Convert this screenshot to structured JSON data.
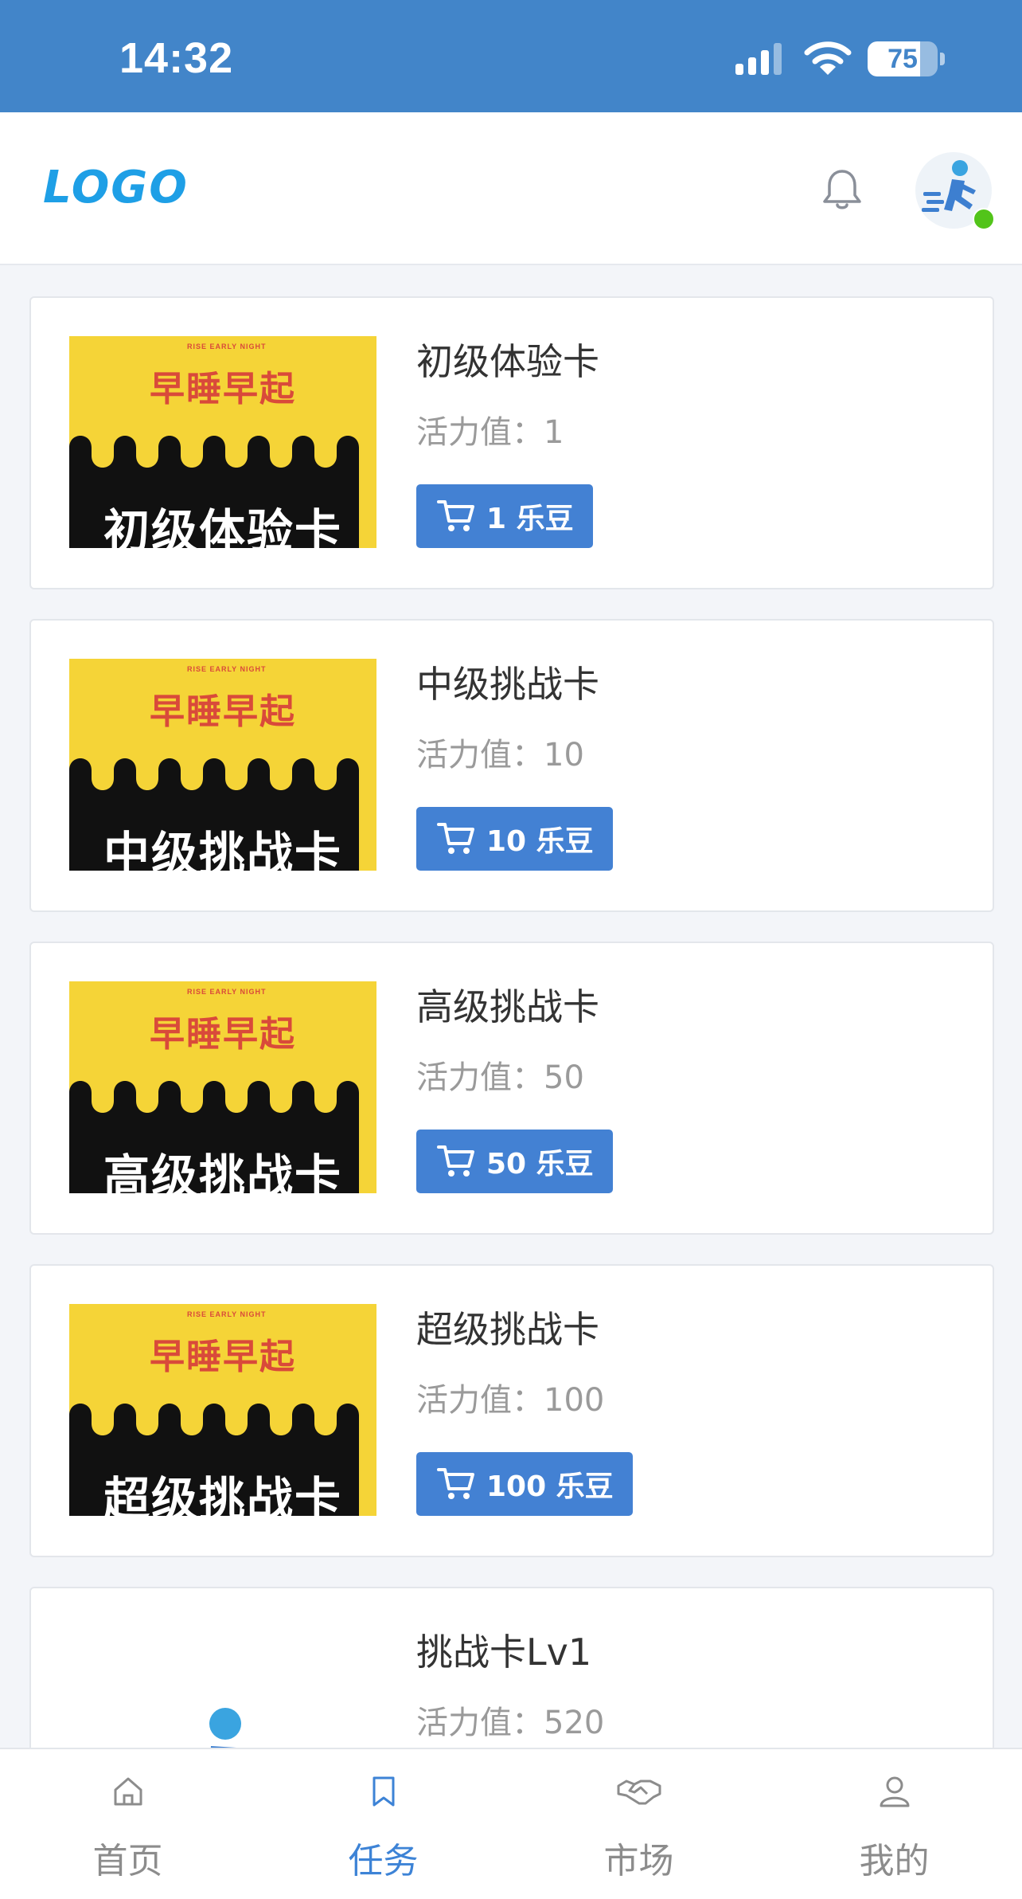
{
  "status_bar": {
    "time": "14:32",
    "battery": "75",
    "battery_level": 0.75
  },
  "header": {
    "logo": "LOGO"
  },
  "products": [
    {
      "name": "初级体验卡",
      "energy": "活力值：1",
      "price": "1 乐豆",
      "thumb_brand": "早睡早起",
      "thumb_small": "RISE EARLY NIGHT",
      "thumb_label": "初级体验卡"
    },
    {
      "name": "中级挑战卡",
      "energy": "活力值：10",
      "price": "10 乐豆",
      "thumb_brand": "早睡早起",
      "thumb_small": "RISE EARLY NIGHT",
      "thumb_label": "中级挑战卡"
    },
    {
      "name": "高级挑战卡",
      "energy": "活力值：50",
      "price": "50 乐豆",
      "thumb_brand": "早睡早起",
      "thumb_small": "RISE EARLY NIGHT",
      "thumb_label": "高级挑战卡"
    },
    {
      "name": "超级挑战卡",
      "energy": "活力值：100",
      "price": "100 乐豆",
      "thumb_brand": "早睡早起",
      "thumb_small": "RISE EARLY NIGHT",
      "thumb_label": "超级挑战卡"
    },
    {
      "name": "挑战卡Lv1",
      "energy": "活力值：520"
    }
  ],
  "tabs": [
    {
      "label": "首页",
      "icon": "home-icon",
      "active": false
    },
    {
      "label": "任务",
      "icon": "bookmark-icon",
      "active": true
    },
    {
      "label": "市场",
      "icon": "handshake-icon",
      "active": false
    },
    {
      "label": "我的",
      "icon": "user-icon",
      "active": false
    }
  ],
  "colors": {
    "primary": "#4381d3",
    "status_bar": "#4285c9",
    "logo": "#1e9fe6",
    "active_tab": "#3d83d6",
    "thumb_yellow": "#f5d437",
    "online": "#52c41a"
  }
}
